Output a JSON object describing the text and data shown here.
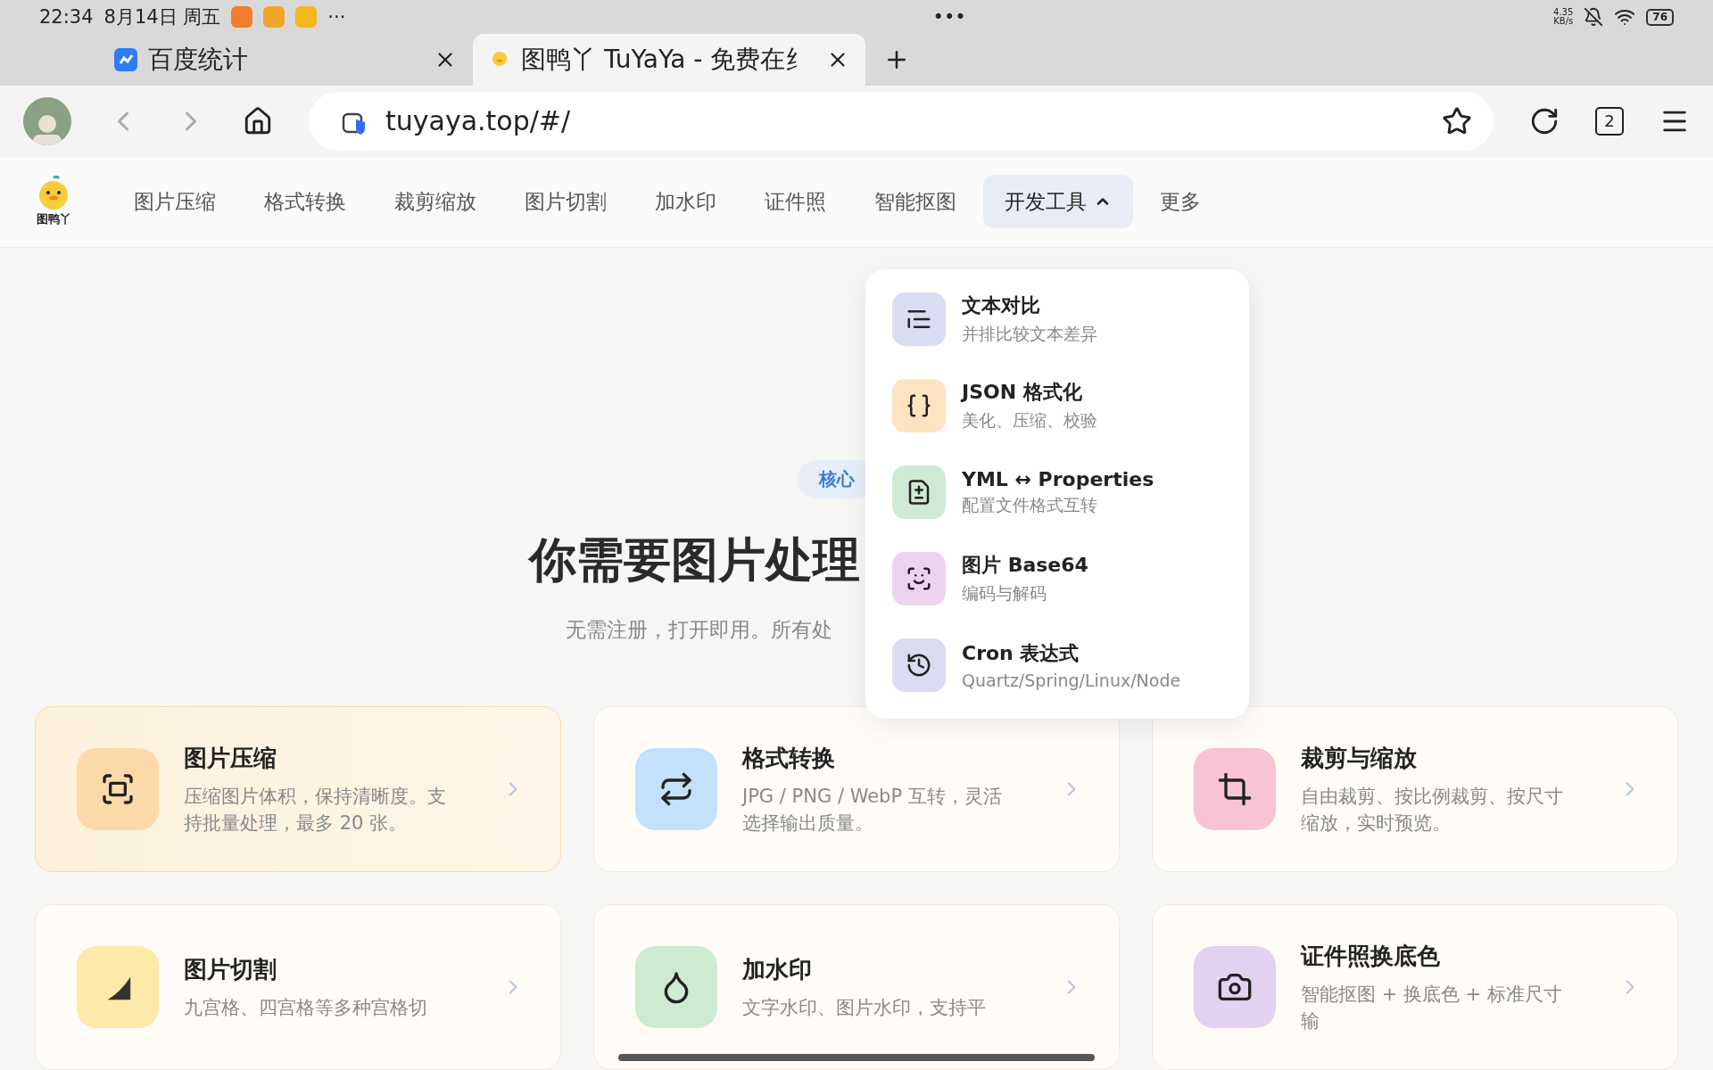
{
  "status_bar": {
    "time": "22:34",
    "date": "8月14日 周五",
    "more": "···",
    "center": "•••",
    "speed": "4.35\nKB/s",
    "battery": "76",
    "apps": [
      {
        "color": "#f47c2c"
      },
      {
        "color": "#f3a42a"
      },
      {
        "color": "#f5b81d"
      }
    ]
  },
  "tabs": [
    {
      "title": "百度统计",
      "selected": false,
      "kind": "baidu"
    },
    {
      "title": "图鸭丫 TuYaYa - 免费在纟",
      "selected": true,
      "kind": "duck"
    }
  ],
  "address_bar": {
    "url": "tuyaya.top/#/",
    "tab_count": "2"
  },
  "site_nav": {
    "logo": "图鸭丫",
    "items": [
      {
        "label": "图片压缩",
        "selected": false
      },
      {
        "label": "格式转换",
        "selected": false
      },
      {
        "label": "裁剪缩放",
        "selected": false
      },
      {
        "label": "图片切割",
        "selected": false
      },
      {
        "label": "加水印",
        "selected": false
      },
      {
        "label": "证件照",
        "selected": false
      },
      {
        "label": "智能抠图",
        "selected": false
      },
      {
        "label": "开发工具",
        "selected": true,
        "expanded": true
      },
      {
        "label": "更多",
        "selected": false
      }
    ]
  },
  "dropdown": [
    {
      "title": "文本对比",
      "subtitle": "并排比较文本差异",
      "color": "#d9dcf2"
    },
    {
      "title": "JSON 格式化",
      "subtitle": "美化、压缩、校验",
      "color": "#fde3bf"
    },
    {
      "title": "YML ↔ Properties",
      "subtitle": "配置文件格式互转",
      "color": "#cfead3"
    },
    {
      "title": "图片 Base64",
      "subtitle": "编码与解码",
      "color": "#ecd3ee"
    },
    {
      "title": "Cron 表达式",
      "subtitle": "Quartz/Spring/Linux/Node",
      "color": "#d9dcf2"
    }
  ],
  "hero": {
    "badge": "核心",
    "title": "你需要图片处理",
    "subtitle": "无需注册，打开即用。所有处"
  },
  "cards": [
    {
      "title": "图片压缩",
      "desc": "压缩图片体积，保持清晰度。支持批量处理，最多 20 张。",
      "color": "#fcd9a8",
      "selected": true
    },
    {
      "title": "格式转换",
      "desc": "JPG / PNG / WebP 互转，灵活选择输出质量。",
      "color": "#c4e0fa",
      "selected": false
    },
    {
      "title": "裁剪与缩放",
      "desc": "自由裁剪、按比例裁剪、按尺寸缩放，实时预览。",
      "color": "#f8c3d5",
      "selected": false
    },
    {
      "title": "图片切割",
      "desc": "九宫格、四宫格等多种宫格切",
      "color": "#fde9a8",
      "selected": false
    },
    {
      "title": "加水印",
      "desc": "文字水印、图片水印，支持平",
      "color": "#cdeccf",
      "selected": false
    },
    {
      "title": "证件照换底色",
      "desc": "智能抠图 + 换底色 + 标准尺寸输",
      "color": "#e4d0f0",
      "selected": false
    }
  ]
}
